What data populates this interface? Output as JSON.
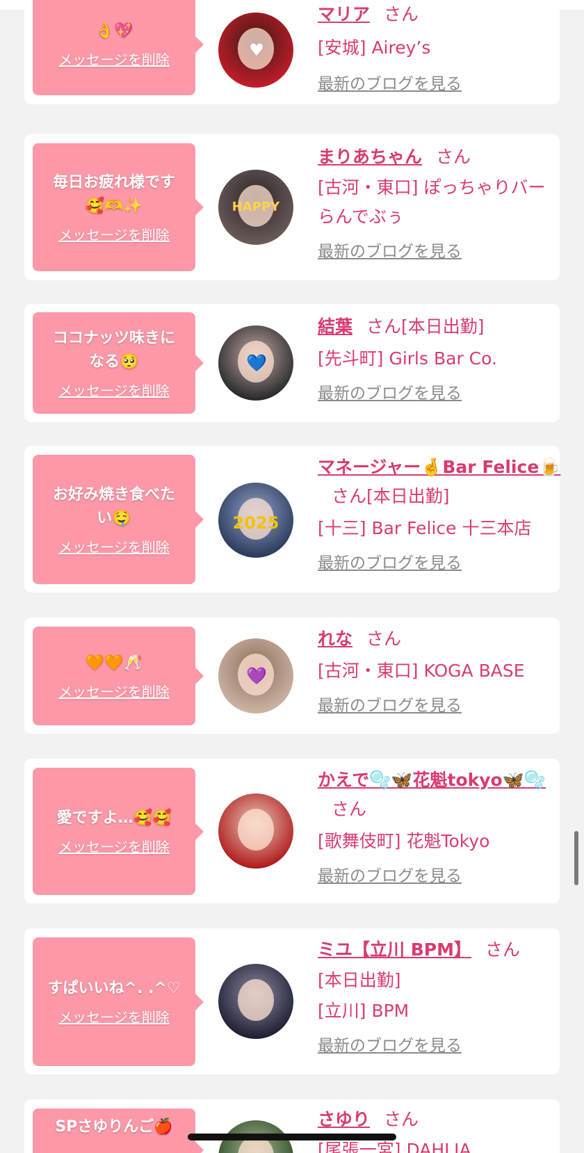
{
  "colors": {
    "bubble": "#fd98a8",
    "accent": "#d93a72",
    "link_gray": "#8a8a8a",
    "background": "#f2f2f2"
  },
  "delete_label": "メッセージを削除",
  "blog_label": "最新のブログを見る",
  "honorific": "さん",
  "cards": [
    {
      "message_lines": [
        "👌💖"
      ],
      "name": "マリア",
      "status": "",
      "shop": "[安城] Airey’s",
      "avatar_colors": [
        "#c21d2a",
        "#3a1a14"
      ],
      "avatar_sticker": "♥"
    },
    {
      "message_lines": [
        "毎日お疲れ様です",
        "🥰🫶✨"
      ],
      "name": "まりあちゃん",
      "status": "",
      "shop": "[古河・東口] ぽっちゃりバー らんでぶぅ",
      "avatar_colors": [
        "#6a5a5a",
        "#2c2424"
      ],
      "avatar_sticker": "HAPPY"
    },
    {
      "message_lines": [
        "ココナッツ味きに",
        "なる🥺"
      ],
      "name": "結葉",
      "status": "[本日出勤]",
      "shop": "[先斗町] Girls Bar Co.",
      "avatar_colors": [
        "#2a2a2e",
        "#bfa8a0"
      ],
      "avatar_sticker": "💙"
    },
    {
      "message_lines": [
        "お好み焼き食べた",
        "い🤤"
      ],
      "name": "マネージャー🤞Bar Felice🍺",
      "status": "[本日出勤]",
      "shop": "[十三] Bar Felice 十三本店",
      "avatar_colors": [
        "#2b3b5c",
        "#8fa2c8"
      ],
      "avatar_sticker": "2025"
    },
    {
      "message_lines": [
        "🧡🧡🥂"
      ],
      "name": "れな",
      "status": "",
      "shop": "[古河・東口] KOGA BASE",
      "avatar_colors": [
        "#cdb3a3",
        "#8b6e5c"
      ],
      "avatar_sticker": "💜"
    },
    {
      "message_lines": [
        "愛ですよ…🥰🥰"
      ],
      "name": "かえで🫧🦋花魁tokyo🦋🫧",
      "status": "",
      "shop": "[歌舞伎町] 花魁Tokyo",
      "avatar_colors": [
        "#b01d1d",
        "#e8c8b8"
      ],
      "avatar_sticker": ""
    },
    {
      "message_lines": [
        "すぱいいね^. .^♡"
      ],
      "name": "ミユ【立川 BPM】",
      "status": "[本日出勤]",
      "shop": "[立川] BPM",
      "avatar_colors": [
        "#1f2033",
        "#8d8aa5"
      ],
      "avatar_sticker": ""
    },
    {
      "message_lines": [
        "SPさゆりんご🍎"
      ],
      "name": "さゆり",
      "status": "",
      "shop": "[尾張一宮] DAHLIA",
      "avatar_colors": [
        "#2f4a2a",
        "#a3b58c"
      ],
      "avatar_sticker": ""
    }
  ]
}
